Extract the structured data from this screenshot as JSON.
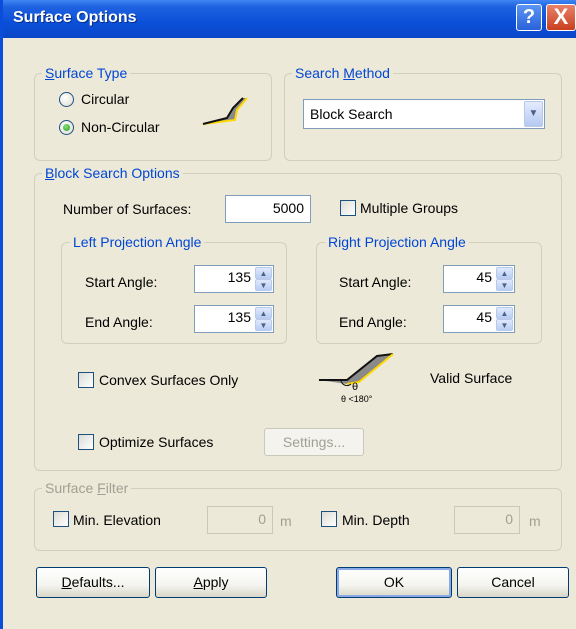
{
  "title": "Surface Options",
  "titlebar": {
    "help": "?",
    "close": "X"
  },
  "surface_type": {
    "legend_pre": "",
    "legend_u": "S",
    "legend_post": "urface Type",
    "options": [
      {
        "label": "Circular",
        "selected": false
      },
      {
        "label": "Non-Circular",
        "selected": true
      }
    ]
  },
  "search_method": {
    "legend_pre": "Search ",
    "legend_u": "M",
    "legend_post": "ethod",
    "value": "Block Search"
  },
  "block_search": {
    "legend_pre": "",
    "legend_u": "B",
    "legend_post": "lock Search Options",
    "num_surfaces_label": "Number of Surfaces:",
    "num_surfaces_value": "5000",
    "multiple_groups_label": "Multiple Groups",
    "left": {
      "legend": "Left Projection Angle",
      "start_label": "Start Angle:",
      "start_value": "135",
      "end_label": "End Angle:",
      "end_value": "135"
    },
    "right": {
      "legend": "Right Projection Angle",
      "start_label": "Start Angle:",
      "start_value": "45",
      "end_label": "End Angle:",
      "end_value": "45"
    },
    "convex_label": "Convex Surfaces Only",
    "valid_surface_label": "Valid Surface",
    "theta_symbol": "θ",
    "theta_constraint": "θ <180°",
    "optimize_label": "Optimize Surfaces",
    "settings_label": "Settings..."
  },
  "surface_filter": {
    "legend_pre": "Surface ",
    "legend_u": "F",
    "legend_post": "ilter",
    "min_elevation_label": "Min. Elevation",
    "min_elevation_value": "0",
    "min_elevation_unit": "m",
    "min_depth_label": "Min. Depth",
    "min_depth_value": "0",
    "min_depth_unit": "m"
  },
  "buttons": {
    "defaults_u": "D",
    "defaults_post": "efaults...",
    "apply_u": "A",
    "apply_post": "pply",
    "ok": "OK",
    "cancel": "Cancel"
  },
  "colors": {
    "titlebar": "#0a4ddb",
    "legend": "#0046d5",
    "face": "#ece9d8"
  }
}
